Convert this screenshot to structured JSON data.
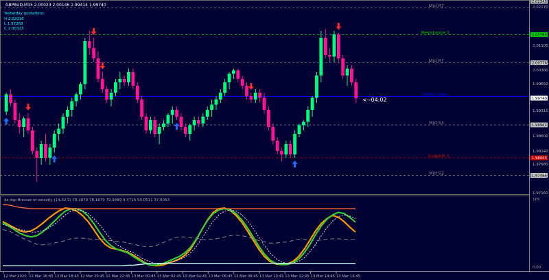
{
  "header": {
    "title": "GBPAUD,M15  2.00023 2.00146 1.99414 1.99740",
    "quotes_title": "Yesterday quotations:",
    "quotes": [
      "H  2.02016",
      "L  1.97268",
      "C  2.00323"
    ]
  },
  "levels": [
    {
      "label": "Mid R2",
      "price": 2.0237,
      "color": "#8a8a8a",
      "style": "dash"
    },
    {
      "label": "Resistance 1",
      "price": 2.0159,
      "color": "#00cc00",
      "style": "dash"
    },
    {
      "label": "Mid R1",
      "price": 2.0077,
      "color": "#8a8a8a",
      "style": "dash"
    },
    {
      "label": "Pivot Level",
      "price": 1.9979,
      "color": "#0000ff",
      "style": "solid"
    },
    {
      "label": "Mid S1",
      "price": 1.9896,
      "color": "#8a8a8a",
      "style": "dash"
    },
    {
      "label": "Support 1",
      "price": 1.98,
      "color": "#cc0000",
      "style": "dash"
    },
    {
      "label": "Mid S2",
      "price": 1.9749,
      "color": "#8a8a8a",
      "style": "dash"
    }
  ],
  "price_axis": {
    "labels": [
      "2.02170",
      "2.01100",
      "2.00380",
      "1.99650",
      "1.99310",
      "1.98600",
      "1.98240",
      "1.97880",
      "1.97160"
    ],
    "tags": [
      {
        "text": "2.02343",
        "bg": "#c0c0c0",
        "fg": "#000000"
      },
      {
        "text": "2.01593",
        "bg": "#00cc00",
        "fg": "#000000"
      },
      {
        "text": "2.00776",
        "bg": "#c0c0c0",
        "fg": "#000000"
      },
      {
        "text": "1.99740",
        "bg": "#ffffff",
        "fg": "#000000"
      },
      {
        "text": "1.98962",
        "bg": "#c0c0c0",
        "fg": "#000000"
      },
      {
        "text": "1.98003",
        "bg": "#cc0000",
        "fg": "#ffffff"
      },
      {
        "text": "1.97495",
        "bg": "#c0c0c0",
        "fg": "#000000"
      }
    ]
  },
  "countdown": "<--04:02",
  "indicator": {
    "title": "dz dsp Bresser of velocity (14,32,9) 78.1879 78.1879 79.9489 9.4715 90.0511 37.6053",
    "axis_top": "105",
    "axis_bottom": "0.00"
  },
  "time_axis": [
    "12 Mar 2020",
    "12 Mar 16:45",
    "12 Mar 18:45",
    "12 Mar 20:45",
    "12 Mar 22:45",
    "13 Mar 00:45",
    "13 Mar 02:45",
    "13 Mar 04:45",
    "13 Mar 06:45",
    "13 Mar 08:45",
    "13 Mar 10:45",
    "13 Mar 12:45",
    "13 Mar 14:45",
    "13 Mar 16:45"
  ],
  "chart_data": {
    "type": "candlestick",
    "symbol": "GBPAUD",
    "timeframe": "M15",
    "y_range": [
      1.97,
      2.0252
    ],
    "candles": [
      [
        1.9935,
        1.999,
        1.9925,
        1.9985
      ],
      [
        1.9985,
        2.0,
        1.995,
        1.996
      ],
      [
        1.996,
        1.997,
        1.99,
        1.991
      ],
      [
        1.991,
        1.993,
        1.987,
        1.989
      ],
      [
        1.989,
        1.992,
        1.986,
        1.9915
      ],
      [
        1.9915,
        1.993,
        1.987,
        1.988
      ],
      [
        1.988,
        1.989,
        1.981,
        1.982
      ],
      [
        1.982,
        1.983,
        1.973,
        1.98
      ],
      [
        1.98,
        1.985,
        1.978,
        1.984
      ],
      [
        1.984,
        1.987,
        1.979,
        1.98
      ],
      [
        1.98,
        1.984,
        1.978,
        1.983
      ],
      [
        1.983,
        1.988,
        1.9815,
        1.987
      ],
      [
        1.987,
        1.99,
        1.985,
        1.9885
      ],
      [
        1.9885,
        1.993,
        1.987,
        1.992
      ],
      [
        1.992,
        1.995,
        1.99,
        1.994
      ],
      [
        1.994,
        1.9975,
        1.992,
        1.9965
      ],
      [
        1.9965,
        1.999,
        1.995,
        1.9985
      ],
      [
        1.9985,
        2.002,
        1.997,
        2.0015
      ],
      [
        2.0015,
        2.015,
        2.0,
        2.014
      ],
      [
        2.014,
        2.017,
        2.01,
        2.012
      ],
      [
        2.012,
        2.015,
        2.008,
        2.009
      ],
      [
        2.009,
        2.011,
        2.002,
        2.003
      ],
      [
        2.003,
        2.005,
        1.999,
        2.0
      ],
      [
        2.0,
        2.001,
        1.996,
        1.997
      ],
      [
        1.997,
        2.0,
        1.995,
        1.999
      ],
      [
        1.999,
        2.003,
        1.998,
        2.002
      ],
      [
        2.002,
        2.005,
        2.0,
        2.003
      ],
      [
        2.003,
        2.004,
        2.001,
        2.002
      ],
      [
        2.002,
        2.006,
        2.001,
        2.005
      ],
      [
        2.005,
        2.006,
        2.0,
        2.001
      ],
      [
        2.001,
        2.002,
        1.996,
        1.997
      ],
      [
        1.997,
        1.998,
        1.991,
        1.992
      ],
      [
        1.992,
        1.993,
        1.987,
        1.988
      ],
      [
        1.988,
        1.992,
        1.987,
        1.991
      ],
      [
        1.991,
        1.992,
        1.986,
        1.987
      ],
      [
        1.987,
        1.99,
        1.984,
        1.989
      ],
      [
        1.989,
        1.991,
        1.988,
        1.99
      ],
      [
        1.99,
        1.993,
        1.989,
        1.9925
      ],
      [
        1.9925,
        1.995,
        1.99,
        1.994
      ],
      [
        1.994,
        1.995,
        1.991,
        1.992
      ],
      [
        1.992,
        1.993,
        1.988,
        1.989
      ],
      [
        1.989,
        1.99,
        1.986,
        1.987
      ],
      [
        1.987,
        1.99,
        1.985,
        1.9895
      ],
      [
        1.9895,
        1.992,
        1.988,
        1.991
      ],
      [
        1.991,
        1.992,
        1.989,
        1.99
      ],
      [
        1.99,
        1.993,
        1.989,
        1.992
      ],
      [
        1.992,
        1.995,
        1.991,
        1.994
      ],
      [
        1.994,
        1.997,
        1.992,
        1.9955
      ],
      [
        1.9955,
        1.998,
        1.994,
        1.997
      ],
      [
        1.997,
        2.0,
        1.996,
        1.999
      ],
      [
        1.999,
        2.003,
        1.998,
        2.002
      ],
      [
        2.002,
        2.005,
        2.0,
        2.0045
      ],
      [
        2.0045,
        2.006,
        2.003,
        2.0055
      ],
      [
        2.0055,
        2.006,
        2.002,
        2.003
      ],
      [
        2.003,
        2.004,
        2.0,
        2.001
      ],
      [
        2.001,
        2.002,
        1.997,
        1.998
      ],
      [
        1.998,
        1.999,
        1.996,
        1.997
      ],
      [
        1.997,
        2.0,
        1.996,
        1.999
      ],
      [
        1.999,
        2.0,
        1.996,
        1.9975
      ],
      [
        1.9975,
        1.999,
        1.993,
        1.994
      ],
      [
        1.994,
        1.995,
        1.988,
        1.989
      ],
      [
        1.989,
        1.99,
        1.984,
        1.985
      ],
      [
        1.985,
        1.986,
        1.981,
        1.982
      ],
      [
        1.982,
        1.983,
        1.979,
        1.981
      ],
      [
        1.981,
        1.985,
        1.98,
        1.984
      ],
      [
        1.984,
        1.985,
        1.98,
        1.981
      ],
      [
        1.981,
        1.988,
        1.98,
        1.987
      ],
      [
        1.987,
        1.99,
        1.986,
        1.9895
      ],
      [
        1.9895,
        1.991,
        1.988,
        1.9905
      ],
      [
        1.9905,
        1.995,
        1.989,
        1.994
      ],
      [
        1.994,
        1.998,
        1.992,
        1.9975
      ],
      [
        1.9975,
        2.005,
        1.996,
        2.004
      ],
      [
        2.004,
        2.017,
        2.002,
        2.015
      ],
      [
        2.015,
        2.0175,
        2.009,
        2.01
      ],
      [
        2.01,
        2.012,
        2.008,
        2.0095
      ],
      [
        2.0095,
        2.017,
        2.008,
        2.016
      ],
      [
        2.016,
        2.0165,
        2.008,
        2.009
      ],
      [
        2.009,
        2.01,
        2.003,
        2.004
      ],
      [
        2.004,
        2.007,
        2.001,
        2.006
      ],
      [
        2.006,
        2.007,
        2.001,
        2.002
      ],
      [
        2.002,
        2.003,
        1.996,
        1.9974
      ]
    ],
    "arrows": [
      {
        "index": 0,
        "dir": "up"
      },
      {
        "index": 5,
        "dir": "down"
      },
      {
        "index": 11,
        "dir": "up"
      },
      {
        "index": 20,
        "dir": "down"
      },
      {
        "index": 22,
        "dir": "down"
      },
      {
        "index": 39,
        "dir": "up"
      },
      {
        "index": 56,
        "dir": "down"
      },
      {
        "index": 66,
        "dir": "up"
      },
      {
        "index": 76,
        "dir": "down"
      }
    ],
    "oscillator": {
      "y_range": [
        0,
        105
      ],
      "series": [
        {
          "color": "#ff9900",
          "width": 2.2,
          "values": [
            75,
            70,
            65,
            60,
            58,
            60,
            65,
            72,
            80,
            87,
            93,
            97,
            96,
            92,
            85,
            75,
            62,
            48,
            38,
            32,
            30,
            28,
            25,
            20,
            14,
            8,
            4,
            3,
            4,
            7,
            10,
            14,
            20,
            30,
            45,
            62,
            78,
            90,
            96,
            97,
            93,
            85,
            74,
            60,
            45,
            30,
            18,
            10,
            6,
            5,
            6,
            10,
            18,
            30,
            45,
            60,
            72,
            80,
            85,
            82,
            75,
            66,
            58
          ]
        },
        {
          "color": "#33cc33",
          "width": 2.2,
          "values": [
            73,
            68,
            62,
            56,
            52,
            50,
            52,
            58,
            66,
            75,
            84,
            92,
            96,
            96,
            92,
            84,
            72,
            58,
            45,
            36,
            30,
            27,
            24,
            18,
            12,
            7,
            4,
            4,
            6,
            10,
            14,
            18,
            24,
            33,
            46,
            62,
            77,
            88,
            94,
            96,
            94,
            88,
            78,
            65,
            50,
            35,
            22,
            12,
            7,
            5,
            5,
            8,
            14,
            24,
            38,
            54,
            68,
            79,
            86,
            90,
            88,
            82,
            74
          ]
        },
        {
          "color": "#dddddd",
          "width": 1,
          "dash": "2,2",
          "values": [
            70,
            68,
            65,
            62,
            60,
            58,
            58,
            60,
            64,
            70,
            78,
            86,
            92,
            94,
            93,
            88,
            80,
            70,
            58,
            46,
            38,
            32,
            28,
            24,
            18,
            13,
            9,
            6,
            6,
            8,
            10,
            13,
            17,
            24,
            34,
            48,
            62,
            76,
            86,
            92,
            94,
            92,
            86,
            77,
            64,
            50,
            36,
            24,
            15,
            9,
            7,
            7,
            10,
            16,
            26,
            38,
            52,
            65,
            76,
            83,
            86,
            84,
            80
          ]
        },
        {
          "color": "#888888",
          "width": 1,
          "dash": "6,4",
          "values": [
            62,
            60,
            56,
            50,
            46,
            42,
            38,
            37,
            38,
            40,
            42,
            44,
            47,
            48,
            48,
            47,
            46,
            46,
            45,
            44,
            43,
            42,
            40,
            38,
            36,
            34,
            34,
            36,
            40,
            44,
            48,
            50,
            50,
            49,
            48,
            46,
            45,
            46,
            48,
            50,
            52,
            53,
            52,
            50,
            47,
            44,
            42,
            40,
            40,
            41,
            42,
            44,
            46,
            46,
            45,
            44,
            45,
            46,
            47,
            47,
            46,
            46,
            46
          ]
        },
        {
          "color": "#ff6633",
          "width": 1.4,
          "values": [
            103,
            102,
            100,
            98,
            97,
            96,
            96,
            96,
            96,
            96,
            96,
            96,
            96,
            96,
            96,
            96,
            96,
            96,
            96,
            96,
            96,
            96,
            96,
            96,
            96,
            96,
            96,
            96,
            96,
            96,
            96,
            96,
            96,
            96,
            96,
            96,
            96,
            96,
            96,
            96,
            96,
            96,
            96,
            96,
            96,
            96,
            96,
            96,
            96,
            96,
            96,
            96,
            96,
            96,
            96,
            96,
            96,
            96,
            96,
            96,
            96,
            96,
            96
          ]
        },
        {
          "color": "#ccffff",
          "width": 1.4,
          "values": [
            3,
            3,
            3,
            3,
            3,
            3,
            3,
            3,
            3,
            3,
            3,
            3,
            3,
            3,
            3,
            3,
            3,
            3,
            3,
            3,
            3,
            3,
            4,
            4,
            5,
            6,
            7,
            7,
            7,
            7,
            7,
            7,
            7,
            7,
            7,
            7,
            7,
            7,
            7,
            7,
            7,
            7,
            7,
            7,
            7,
            7,
            7,
            7,
            7,
            7,
            7,
            7,
            7,
            7,
            7,
            7,
            7,
            7,
            7,
            7,
            7,
            7,
            7
          ]
        }
      ]
    }
  }
}
